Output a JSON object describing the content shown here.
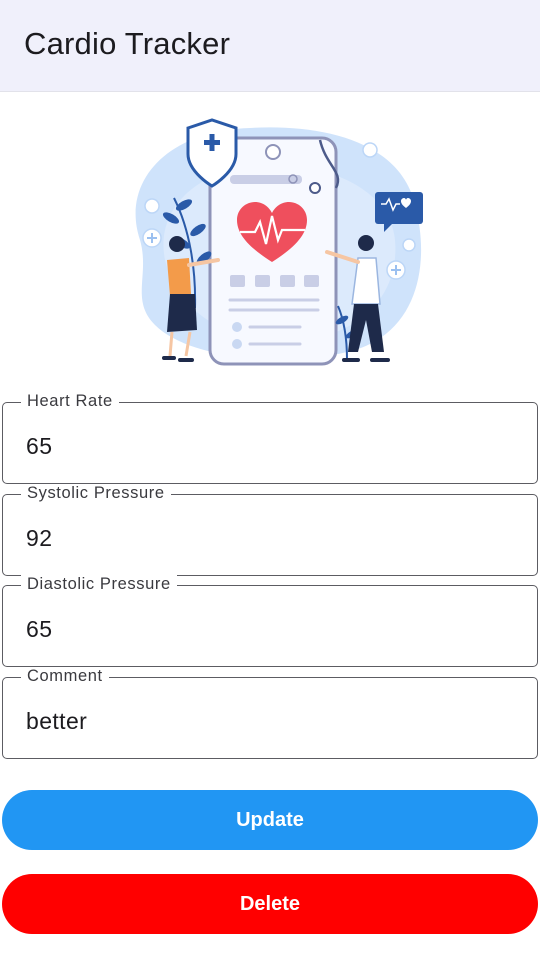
{
  "appbar": {
    "title": "Cardio Tracker"
  },
  "fields": {
    "heart_rate": {
      "label": "Heart Rate",
      "value": "65"
    },
    "systolic": {
      "label": "Systolic Pressure",
      "value": "92"
    },
    "diastolic": {
      "label": "Diastolic Pressure",
      "value": "65"
    },
    "comment": {
      "label": "Comment",
      "value": "better"
    }
  },
  "buttons": {
    "update": "Update",
    "delete": "Delete"
  },
  "colors": {
    "update": "#2196f3",
    "delete": "#ff0000",
    "appbar": "#f0f0fb",
    "heart": "#ef4f5d"
  },
  "illustration": {
    "icon": "health-check-illustration"
  }
}
